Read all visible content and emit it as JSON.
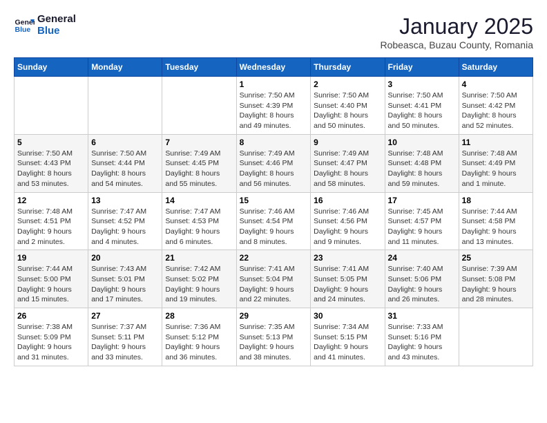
{
  "logo": {
    "line1": "General",
    "line2": "Blue"
  },
  "title": "January 2025",
  "subtitle": "Robeasca, Buzau County, Romania",
  "weekdays": [
    "Sunday",
    "Monday",
    "Tuesday",
    "Wednesday",
    "Thursday",
    "Friday",
    "Saturday"
  ],
  "weeks": [
    [
      {
        "day": "",
        "sunrise": "",
        "sunset": "",
        "daylight": ""
      },
      {
        "day": "",
        "sunrise": "",
        "sunset": "",
        "daylight": ""
      },
      {
        "day": "",
        "sunrise": "",
        "sunset": "",
        "daylight": ""
      },
      {
        "day": "1",
        "sunrise": "7:50 AM",
        "sunset": "4:39 PM",
        "daylight": "8 hours and 49 minutes."
      },
      {
        "day": "2",
        "sunrise": "7:50 AM",
        "sunset": "4:40 PM",
        "daylight": "8 hours and 50 minutes."
      },
      {
        "day": "3",
        "sunrise": "7:50 AM",
        "sunset": "4:41 PM",
        "daylight": "8 hours and 50 minutes."
      },
      {
        "day": "4",
        "sunrise": "7:50 AM",
        "sunset": "4:42 PM",
        "daylight": "8 hours and 52 minutes."
      }
    ],
    [
      {
        "day": "5",
        "sunrise": "7:50 AM",
        "sunset": "4:43 PM",
        "daylight": "8 hours and 53 minutes."
      },
      {
        "day": "6",
        "sunrise": "7:50 AM",
        "sunset": "4:44 PM",
        "daylight": "8 hours and 54 minutes."
      },
      {
        "day": "7",
        "sunrise": "7:49 AM",
        "sunset": "4:45 PM",
        "daylight": "8 hours and 55 minutes."
      },
      {
        "day": "8",
        "sunrise": "7:49 AM",
        "sunset": "4:46 PM",
        "daylight": "8 hours and 56 minutes."
      },
      {
        "day": "9",
        "sunrise": "7:49 AM",
        "sunset": "4:47 PM",
        "daylight": "8 hours and 58 minutes."
      },
      {
        "day": "10",
        "sunrise": "7:48 AM",
        "sunset": "4:48 PM",
        "daylight": "8 hours and 59 minutes."
      },
      {
        "day": "11",
        "sunrise": "7:48 AM",
        "sunset": "4:49 PM",
        "daylight": "9 hours and 1 minute."
      }
    ],
    [
      {
        "day": "12",
        "sunrise": "7:48 AM",
        "sunset": "4:51 PM",
        "daylight": "9 hours and 2 minutes."
      },
      {
        "day": "13",
        "sunrise": "7:47 AM",
        "sunset": "4:52 PM",
        "daylight": "9 hours and 4 minutes."
      },
      {
        "day": "14",
        "sunrise": "7:47 AM",
        "sunset": "4:53 PM",
        "daylight": "9 hours and 6 minutes."
      },
      {
        "day": "15",
        "sunrise": "7:46 AM",
        "sunset": "4:54 PM",
        "daylight": "9 hours and 8 minutes."
      },
      {
        "day": "16",
        "sunrise": "7:46 AM",
        "sunset": "4:56 PM",
        "daylight": "9 hours and 9 minutes."
      },
      {
        "day": "17",
        "sunrise": "7:45 AM",
        "sunset": "4:57 PM",
        "daylight": "9 hours and 11 minutes."
      },
      {
        "day": "18",
        "sunrise": "7:44 AM",
        "sunset": "4:58 PM",
        "daylight": "9 hours and 13 minutes."
      }
    ],
    [
      {
        "day": "19",
        "sunrise": "7:44 AM",
        "sunset": "5:00 PM",
        "daylight": "9 hours and 15 minutes."
      },
      {
        "day": "20",
        "sunrise": "7:43 AM",
        "sunset": "5:01 PM",
        "daylight": "9 hours and 17 minutes."
      },
      {
        "day": "21",
        "sunrise": "7:42 AM",
        "sunset": "5:02 PM",
        "daylight": "9 hours and 19 minutes."
      },
      {
        "day": "22",
        "sunrise": "7:41 AM",
        "sunset": "5:04 PM",
        "daylight": "9 hours and 22 minutes."
      },
      {
        "day": "23",
        "sunrise": "7:41 AM",
        "sunset": "5:05 PM",
        "daylight": "9 hours and 24 minutes."
      },
      {
        "day": "24",
        "sunrise": "7:40 AM",
        "sunset": "5:06 PM",
        "daylight": "9 hours and 26 minutes."
      },
      {
        "day": "25",
        "sunrise": "7:39 AM",
        "sunset": "5:08 PM",
        "daylight": "9 hours and 28 minutes."
      }
    ],
    [
      {
        "day": "26",
        "sunrise": "7:38 AM",
        "sunset": "5:09 PM",
        "daylight": "9 hours and 31 minutes."
      },
      {
        "day": "27",
        "sunrise": "7:37 AM",
        "sunset": "5:11 PM",
        "daylight": "9 hours and 33 minutes."
      },
      {
        "day": "28",
        "sunrise": "7:36 AM",
        "sunset": "5:12 PM",
        "daylight": "9 hours and 36 minutes."
      },
      {
        "day": "29",
        "sunrise": "7:35 AM",
        "sunset": "5:13 PM",
        "daylight": "9 hours and 38 minutes."
      },
      {
        "day": "30",
        "sunrise": "7:34 AM",
        "sunset": "5:15 PM",
        "daylight": "9 hours and 41 minutes."
      },
      {
        "day": "31",
        "sunrise": "7:33 AM",
        "sunset": "5:16 PM",
        "daylight": "9 hours and 43 minutes."
      },
      {
        "day": "",
        "sunrise": "",
        "sunset": "",
        "daylight": ""
      }
    ]
  ]
}
